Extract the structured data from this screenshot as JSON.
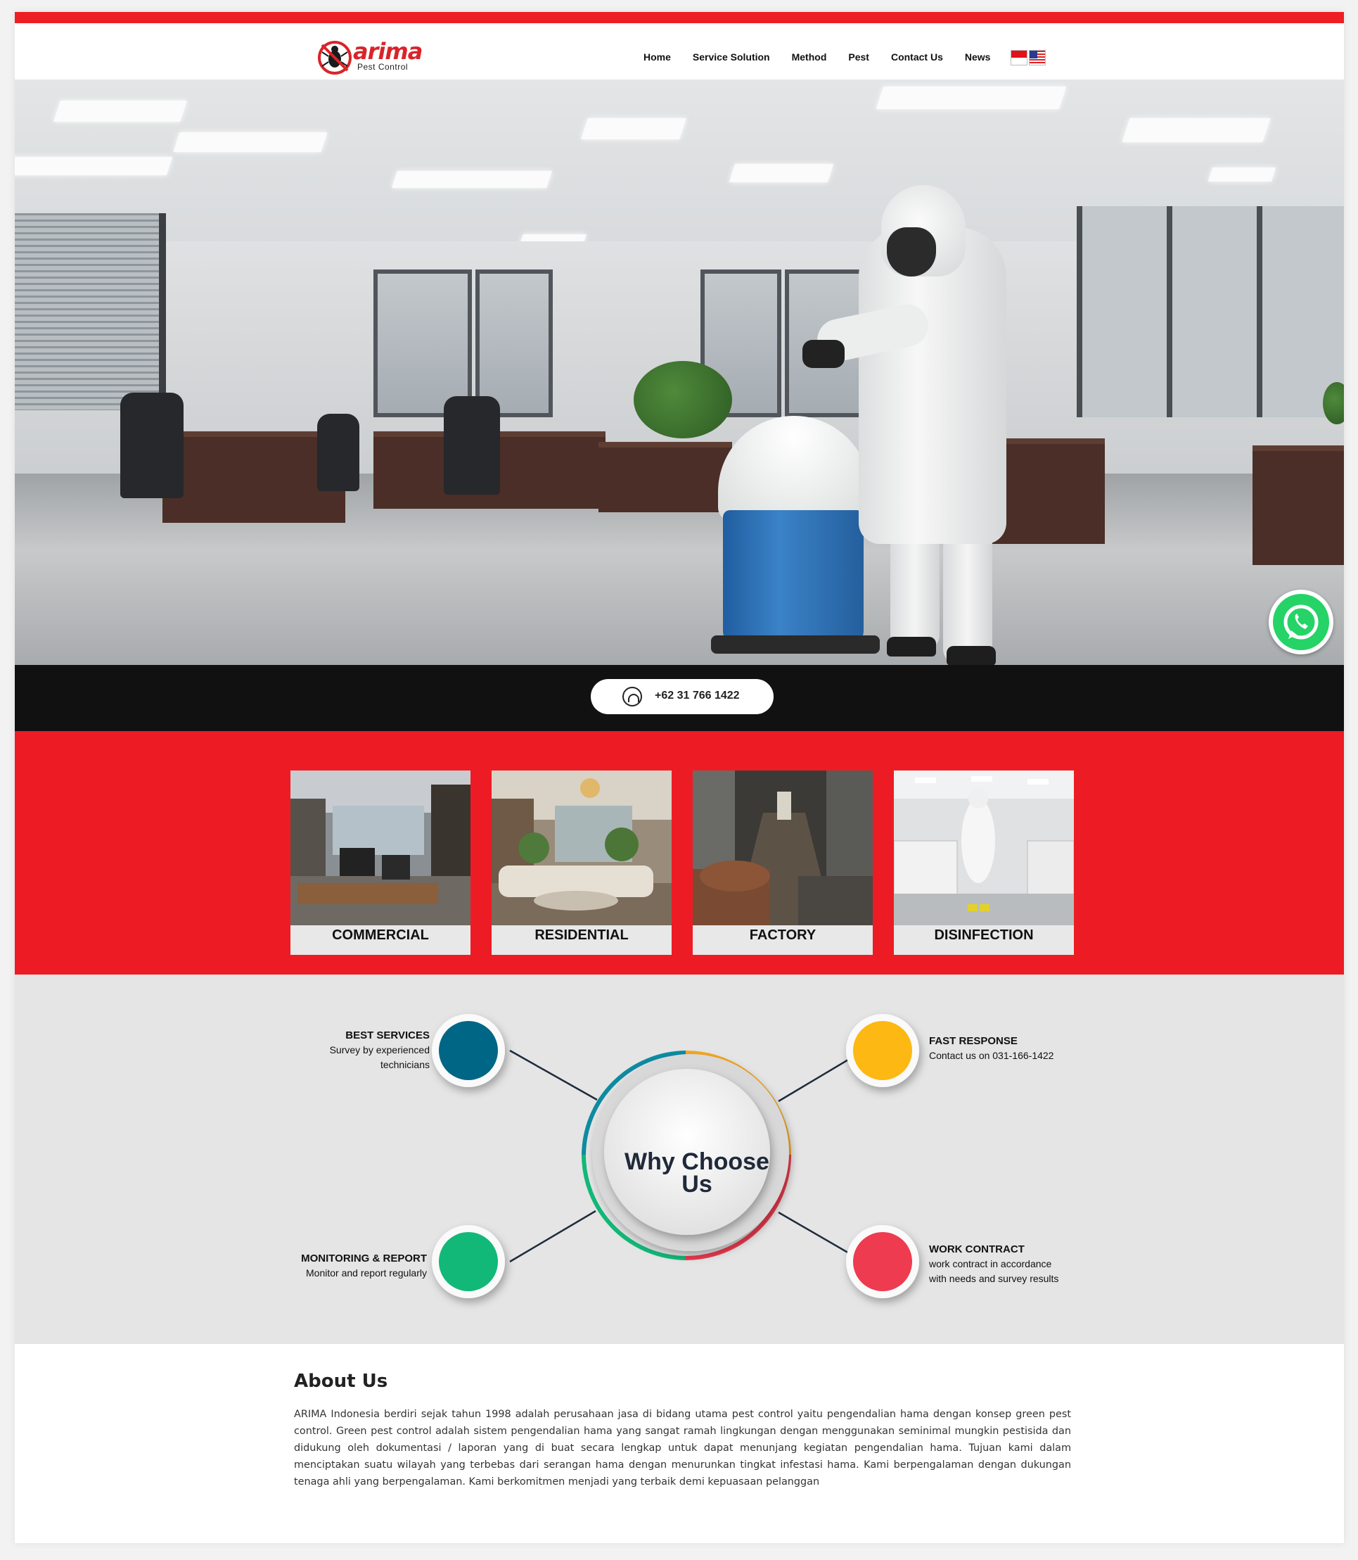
{
  "brand": {
    "name": "arima",
    "tagline": "Pest Control",
    "color": "#ee1f24"
  },
  "nav": {
    "items": [
      "Home",
      "Service Solution",
      "Method",
      "Pest",
      "Contact Us",
      "News"
    ],
    "languages": [
      "Indonesia",
      "English"
    ]
  },
  "contact": {
    "phone": "+62 31 766 1422",
    "whatsapp_icon": "whatsapp-icon"
  },
  "services": [
    {
      "label": "COMMERCIAL"
    },
    {
      "label": "RESIDENTIAL"
    },
    {
      "label": "FACTORY"
    },
    {
      "label": "DISINFECTION"
    }
  ],
  "why": {
    "title_line1": "Why Choose",
    "title_line2": "Us",
    "points": [
      {
        "title": "BEST SERVICES",
        "line1": "Survey by experienced",
        "line2": "technicians",
        "color": "#006685"
      },
      {
        "title": "FAST RESPONSE",
        "line1": "Contact us on 031-166-1422",
        "line2": "",
        "color": "#fdb813"
      },
      {
        "title": "MONITORING & REPORT",
        "line1": "Monitor and report regularly",
        "line2": "",
        "color": "#12b878"
      },
      {
        "title": "WORK CONTRACT",
        "line1": "work contract in accordance",
        "line2": "with needs and survey results",
        "color": "#ee3b4f"
      }
    ]
  },
  "about": {
    "title": "About Us",
    "text": "ARIMA Indonesia berdiri sejak tahun 1998 adalah perusahaan jasa di bidang utama pest control yaitu pengendalian hama dengan konsep green pest control. Green pest control adalah sistem pengendalian hama yang sangat ramah lingkungan dengan menggunakan seminimal mungkin pestisida dan didukung oleh dokumentasi / laporan yang di buat secara lengkap untuk dapat menunjang kegiatan pengendalian hama. Tujuan kami dalam menciptakan suatu wilayah yang terbebas dari serangan hama dengan menurunkan tingkat infestasi hama. Kami berpengalaman dengan dukungan tenaga ahli yang berpengalaman. Kami berkomitmen menjadi yang terbaik demi kepuasaan pelanggan"
  }
}
